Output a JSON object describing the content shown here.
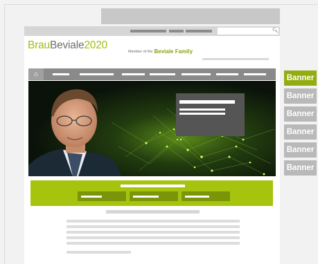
{
  "logo": {
    "part1": "Brau",
    "part2": "Beviale",
    "part3": "2020"
  },
  "member": {
    "prefix": "Member of the",
    "family": "Beviale Family"
  },
  "search": {
    "icon": "magnifier-icon"
  },
  "nav": {
    "home_icon": "home-icon"
  },
  "banners": [
    {
      "label": "Banner",
      "active": true
    },
    {
      "label": "Banner",
      "active": false
    },
    {
      "label": "Banner",
      "active": false
    },
    {
      "label": "Banner",
      "active": false
    },
    {
      "label": "Banner",
      "active": false
    },
    {
      "label": "Banner",
      "active": false
    }
  ],
  "colors": {
    "accent": "#a6c40d",
    "banner_active": "#93ad10",
    "banner_inactive": "#b9b9b9",
    "nav": "#8a8a8a"
  }
}
